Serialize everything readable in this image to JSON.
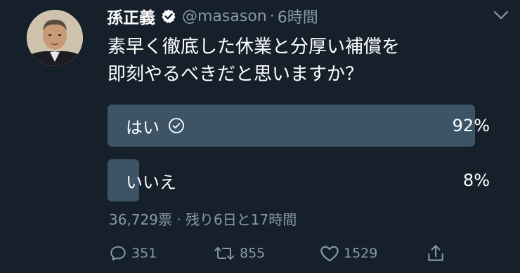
{
  "author": {
    "name": "孫正義",
    "handle": "@masason",
    "separator": "·",
    "time": "6時間"
  },
  "tweet": {
    "lines": [
      "素早く徹底した休業と分厚い補償を",
      "即刻やるべきだと思いますか？"
    ]
  },
  "poll": {
    "options": [
      {
        "label": "はい",
        "percent_label": "92%",
        "percent": 92,
        "selected": true
      },
      {
        "label": "いいえ",
        "percent_label": "8%",
        "percent": 8,
        "selected": false
      }
    ],
    "meta": "36,729票 · 残り6日と17時間"
  },
  "actions": {
    "replies": "351",
    "retweets": "855",
    "likes": "1529"
  },
  "colors": {
    "background": "#15202b",
    "bar": "#3d5466",
    "secondary_text": "#8899a6",
    "verified": "#ffffff"
  }
}
